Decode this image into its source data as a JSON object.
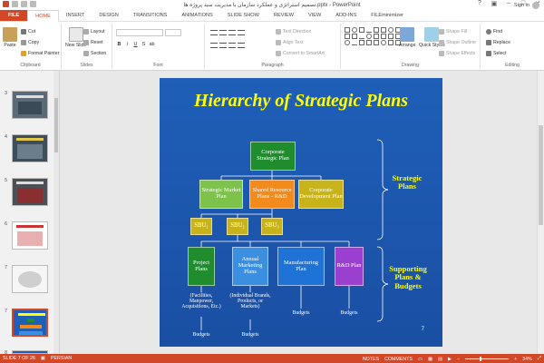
{
  "window": {
    "title": "تصمیم استراتژی و عملکرد سازمان با مدیریت سبد پروژه ها.pptx - PowerPoint",
    "signin": "Sign in"
  },
  "tabs": [
    "FILE",
    "HOME",
    "INSERT",
    "DESIGN",
    "TRANSITIONS",
    "ANIMATIONS",
    "SLIDE SHOW",
    "REVIEW",
    "VIEW",
    "ADD-INS",
    "FILEminimizer"
  ],
  "active_tab": "HOME",
  "ribbon": {
    "clipboard": {
      "label": "Clipboard",
      "paste": "Paste",
      "cut": "Cut",
      "copy": "Copy",
      "format_painter": "Format Painter"
    },
    "slides": {
      "label": "Slides",
      "new_slide": "New Slide",
      "layout": "Layout",
      "reset": "Reset",
      "section": "Section"
    },
    "font": {
      "label": "Font"
    },
    "paragraph": {
      "label": "Paragraph",
      "text_direction": "Text Direction",
      "align_text": "Align Text",
      "convert_smartart": "Convert to SmartArt"
    },
    "drawing": {
      "label": "Drawing",
      "arrange": "Arrange",
      "quick_styles": "Quick Styles",
      "shape_fill": "Shape Fill",
      "shape_outline": "Shape Outline",
      "shape_effects": "Shape Effects"
    },
    "editing": {
      "label": "Editing",
      "find": "Find",
      "replace": "Replace",
      "select": "Select"
    }
  },
  "thumbnails": [
    {
      "num": "3"
    },
    {
      "num": "4"
    },
    {
      "num": "5"
    },
    {
      "num": "6"
    },
    {
      "num": "7",
      "selected": true
    },
    {
      "num": "8"
    }
  ],
  "slide": {
    "title": "Hierarchy of Strategic Plans",
    "corporate": "Corporate Strategic Plan",
    "market": "Strategic Market Plan",
    "shared": "Shared Resource Plans - R&D",
    "corpdev": "Corporate Development Plan",
    "sbu1": "SBU₁",
    "sbu2": "SBU₂",
    "sbu3": "SBU₃",
    "project": "Project Plans",
    "marketing": "Annual Marketing Plans",
    "manufacturing": "Manufacturing Plan",
    "rnd": "R&D Plan",
    "project_note": "(Facilities, Manpower, Acquisitions, Etc.)",
    "marketing_note": "(Individual Brands, Products, or Markets)",
    "budgets": "Budgets",
    "strategic_plans": "Strategic Plans",
    "supporting": "Supporting Plans & Budgets",
    "page_number": "7"
  },
  "status": {
    "slide_of": "SLIDE 7 OF 26",
    "language": "PERSIAN",
    "notes": "NOTES",
    "comments": "COMMENTS",
    "zoom": "34%"
  },
  "colors": {
    "accent": "#d24726",
    "slide_bg": "#1f5fb8",
    "title": "#ffff00",
    "green_dark": "#1f8c2e",
    "green_light": "#7dc24a",
    "orange": "#f28a1c",
    "olive": "#c9b31a",
    "blue_light": "#3b8fe0",
    "purple": "#9b3fd1"
  }
}
